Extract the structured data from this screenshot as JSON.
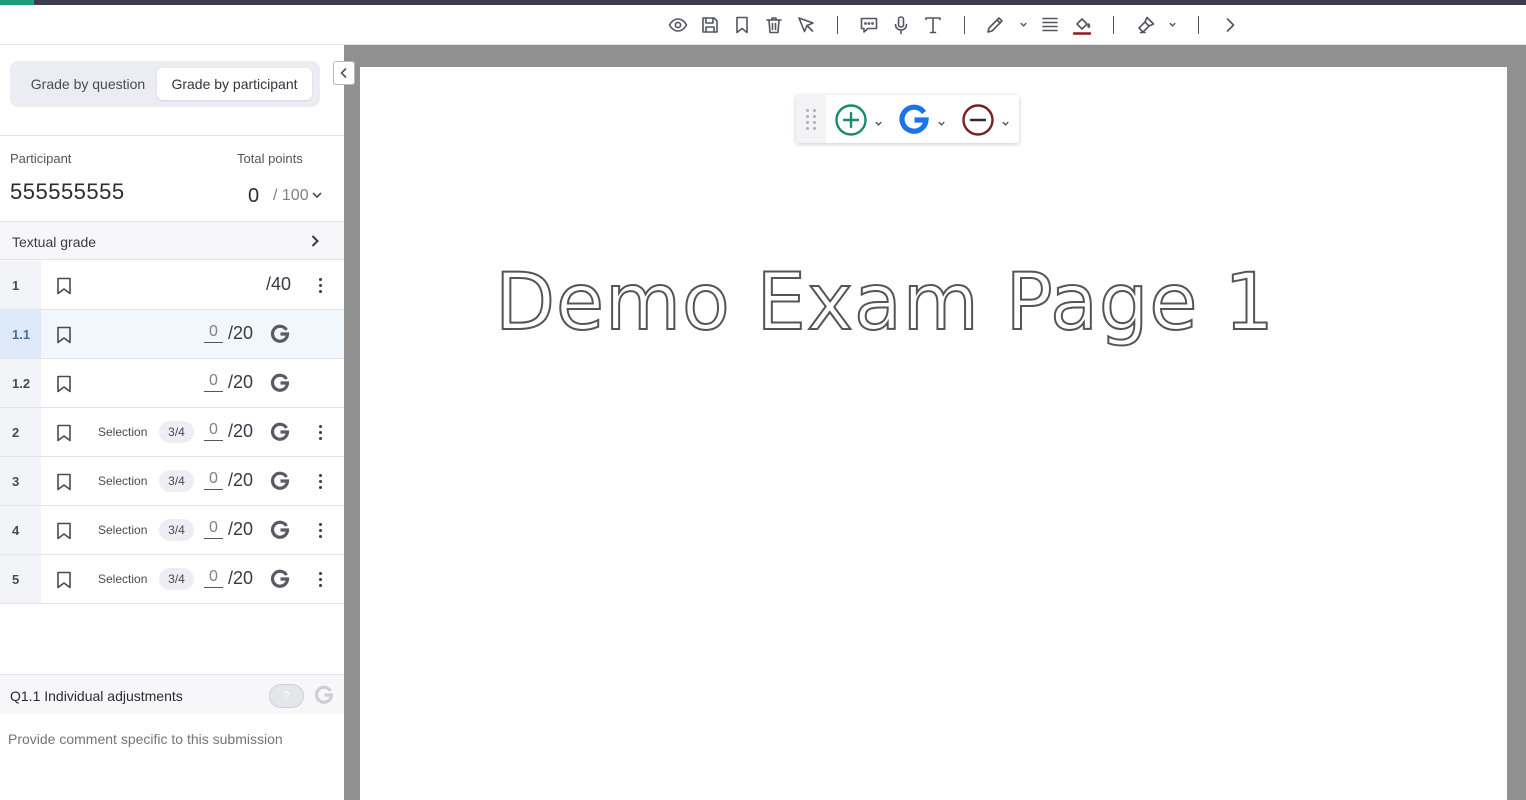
{
  "toolbar": {
    "icons": [
      "eye-icon",
      "save-icon",
      "bookmark-icon",
      "trash-icon",
      "pointer-icon",
      "comment-icon",
      "microphone-icon",
      "text-icon",
      "pencil-icon",
      "lines-icon",
      "fill-color-icon",
      "stamp-icon",
      "chevron-right-icon"
    ],
    "fill_color": "#8b1c1c"
  },
  "sidebar": {
    "grade_by_question": "Grade by question",
    "grade_by_participant": "Grade by participant",
    "participant_label": "Participant",
    "total_points_label": "Total points",
    "participant_id": "555555555",
    "total_score": "0",
    "total_max": "/ 100",
    "textual_grade": "Textual grade",
    "selection_label": "Selection",
    "questions": [
      {
        "num": "1",
        "max": "/40"
      },
      {
        "num": "1.1",
        "score": "0",
        "max": "/20"
      },
      {
        "num": "1.2",
        "score": "0",
        "max": "/20"
      },
      {
        "num": "2",
        "selection_badge": "3/4",
        "score": "0",
        "max": "/20"
      },
      {
        "num": "3",
        "selection_badge": "3/4",
        "score": "0",
        "max": "/20"
      },
      {
        "num": "4",
        "selection_badge": "3/4",
        "score": "0",
        "max": "/20"
      },
      {
        "num": "5",
        "selection_badge": "3/4",
        "score": "0",
        "max": "/20"
      }
    ],
    "adjustments_title": "Q1.1 Individual adjustments",
    "toggle_label": "?",
    "comment_placeholder": "Provide comment specific to this submission"
  },
  "document": {
    "page_title": "Demo Exam Page 1"
  },
  "colors": {
    "accent": "#1a9e7e",
    "add_mark": "#1a8c6e",
    "deduct_mark": "#7a1f1f",
    "google_blue": "#1a73e8",
    "selected_row": "#f2f7fd"
  }
}
